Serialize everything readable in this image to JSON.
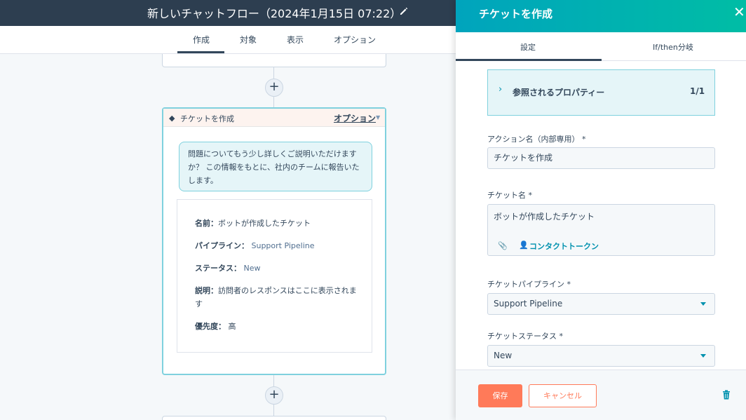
{
  "header": {
    "title": "新しいチャットフロー（2024年1月15日 07:22）"
  },
  "tabs": [
    {
      "label": "作成",
      "active": true
    },
    {
      "label": "対象"
    },
    {
      "label": "表示"
    },
    {
      "label": "オプション"
    }
  ],
  "card": {
    "title": "チケットを作成",
    "options_label": "オプション",
    "message": "問題についてもう少し詳しくご説明いただけますか？ この情報をもとに、社内のチームに報告いたします。",
    "details": [
      {
        "label": "名前：",
        "value": "ボットが作成したチケット"
      },
      {
        "label": "パイプライン：",
        "value": " Support Pipeline"
      },
      {
        "label": "ステータス：",
        "value": " New"
      },
      {
        "label": "説明：",
        "value": "訪問者のレスポンスはここに表示されます"
      },
      {
        "label": "優先度：",
        "value": " 高"
      }
    ]
  },
  "panel": {
    "title": "チケットを作成",
    "tabs": [
      {
        "label": "設定",
        "active": true
      },
      {
        "label": "If/then分岐"
      }
    ],
    "accordion": {
      "label": "参照されるプロパティー",
      "count": "1/1"
    },
    "fields": {
      "action_name_label": "アクション名（内部専用） *",
      "action_name_value": "チケットを作成",
      "ticket_name_label": "チケット名 *",
      "ticket_name_value": "ボットが作成したチケット",
      "contact_token": "コンタクトトークン",
      "pipeline_label": "チケットパイプライン *",
      "pipeline_value": "Support Pipeline",
      "status_label": "チケットステータス *",
      "status_value": "New"
    },
    "footer": {
      "save_label": "保存",
      "cancel_label": "キャンセル"
    }
  },
  "colors": {
    "accent": "#00a4bd",
    "save": "#ff7a59",
    "dark": "#2d3e50"
  }
}
